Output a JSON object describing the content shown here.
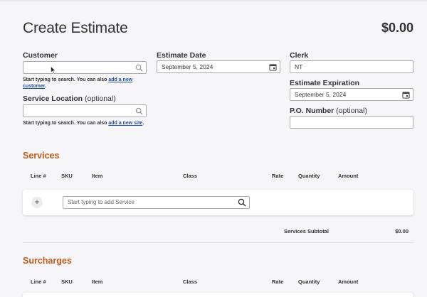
{
  "header": {
    "title": "Create Estimate",
    "total": "$0.00"
  },
  "customer": {
    "label": "Customer",
    "value": "",
    "hint_text": "Start typing to search. You can also ",
    "hint_link": "add a new customer",
    "hint_end": "."
  },
  "estimate_date": {
    "label": "Estimate Date",
    "value": "September 5, 2024"
  },
  "clerk": {
    "label": "Clerk",
    "value": "NT"
  },
  "estimate_expiration": {
    "label": "Estimate Expiration",
    "value": "September 5, 2024"
  },
  "service_location": {
    "label": "Service Location",
    "optional": "(optional)",
    "value": "",
    "hint_text": "Start typing to search. You can also ",
    "hint_link": "add a new site",
    "hint_end": "."
  },
  "po_number": {
    "label": "P.O. Number",
    "optional": "(optional)",
    "value": ""
  },
  "services": {
    "title": "Services",
    "columns": [
      "Line #",
      "SKU",
      "Item",
      "Class",
      "Rate",
      "Quantity",
      "Amount"
    ],
    "add_placeholder": "Start typing to add Service",
    "subtotal_label": "Services Subtotal",
    "subtotal_value": "$0.00"
  },
  "surcharges": {
    "title": "Surcharges",
    "columns": [
      "Line #",
      "SKU",
      "Item",
      "Class",
      "Rate",
      "Quantity",
      "Amount"
    ]
  },
  "icons": {
    "search": "search-icon",
    "calendar": "calendar-icon",
    "add": "plus-icon"
  }
}
